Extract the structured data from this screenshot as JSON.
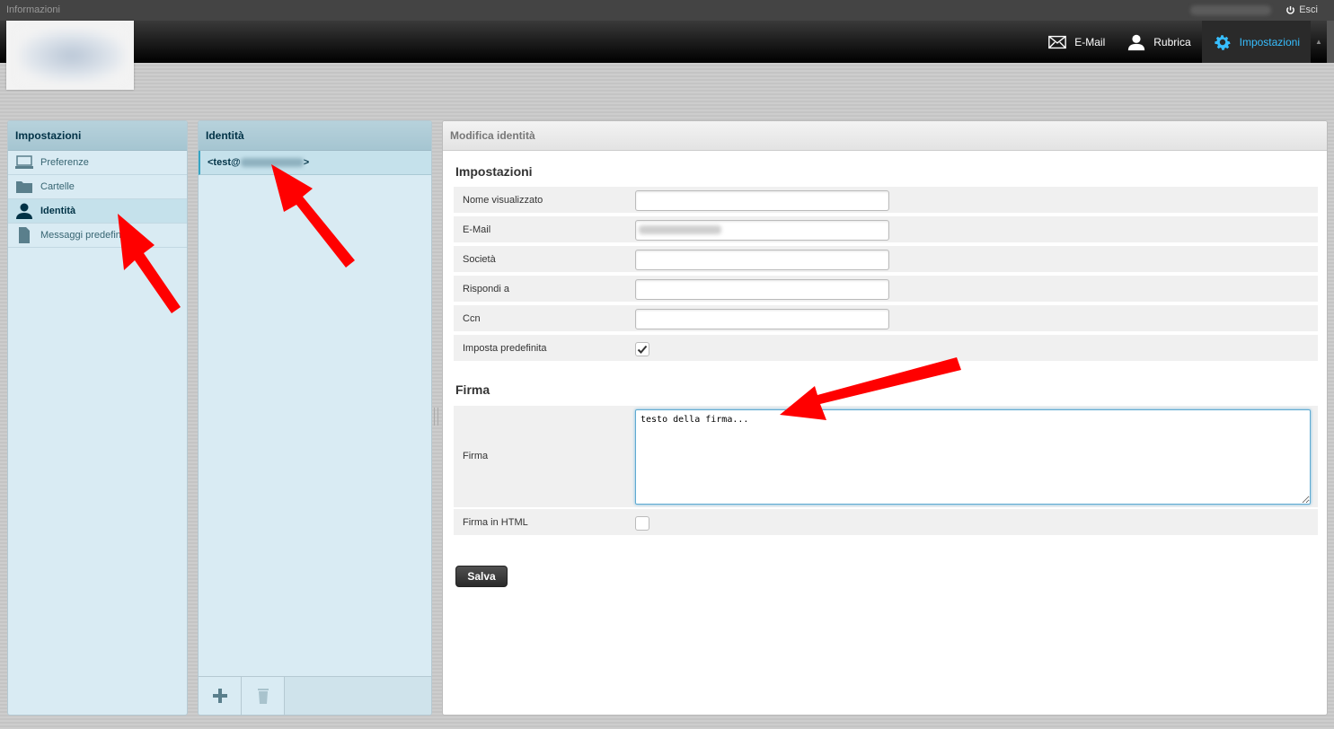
{
  "topline": {
    "info_label": "Informazioni",
    "logout_label": "Esci"
  },
  "nav": {
    "items": [
      {
        "label": "E-Mail",
        "icon": "envelope-icon"
      },
      {
        "label": "Rubrica",
        "icon": "person-icon"
      },
      {
        "label": "Impostazioni",
        "icon": "gear-icon",
        "active": true
      }
    ],
    "active_color": "#37beff"
  },
  "settings": {
    "title": "Impostazioni",
    "tabs": [
      {
        "label": "Preferenze",
        "icon": "monitor-icon"
      },
      {
        "label": "Cartelle",
        "icon": "folder-icon"
      },
      {
        "label": "Identità",
        "icon": "user-icon",
        "selected": true
      },
      {
        "label": "Messaggi predefiniti",
        "icon": "document-icon"
      }
    ]
  },
  "identities": {
    "title": "Identità",
    "rows": [
      {
        "prefix": "<test@",
        "suffix": ">"
      }
    ],
    "footer": {
      "add_icon": "plus-icon",
      "delete_icon": "trash-icon"
    }
  },
  "edit": {
    "title": "Modifica identità",
    "section_settings": "Impostazioni",
    "fields": {
      "name_label": "Nome visualizzato",
      "name_value": "",
      "email_label": "E-Mail",
      "company_label": "Società",
      "company_value": "",
      "reply_label": "Rispondi a",
      "reply_value": "",
      "bcc_label": "Ccn",
      "bcc_value": "",
      "default_label": "Imposta predefinita",
      "default_checked": true
    },
    "section_signature": "Firma",
    "signature": {
      "label": "Firma",
      "value": "testo della firma...",
      "html_label": "Firma in HTML",
      "html_checked": false
    },
    "save_label": "Salva"
  },
  "colors": {
    "panel_bg": "#d9ebf3",
    "panel_header": "#a5c5d1",
    "annotation_arrow": "#ff0000"
  }
}
